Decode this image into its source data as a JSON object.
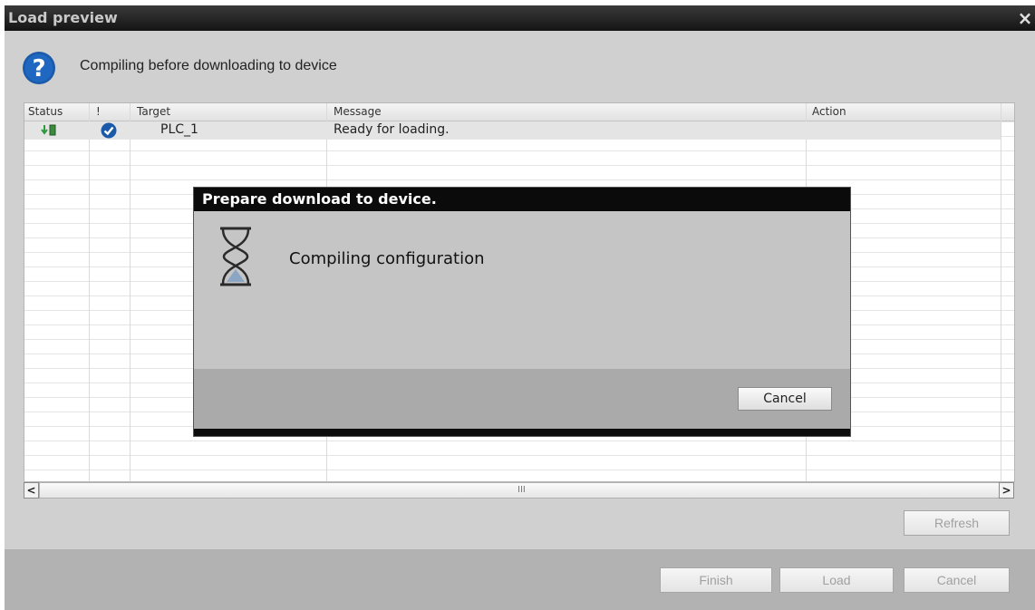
{
  "window": {
    "title": "Load preview",
    "close_symbol": "×"
  },
  "prompt": {
    "icon": "question-icon",
    "text": "Compiling before downloading to device"
  },
  "table": {
    "columns": [
      "Status",
      "!",
      "Target",
      "Message",
      "Action"
    ],
    "rows": [
      {
        "status_icon": "download-status-icon",
        "check_icon": "check-icon",
        "target": "PLC_1",
        "message": "Ready for loading.",
        "action": ""
      }
    ]
  },
  "scrollbar": {
    "left_arrow": "<",
    "right_arrow": ">",
    "grip": "III"
  },
  "buttons": {
    "refresh": "Refresh",
    "finish": "Finish",
    "load": "Load",
    "cancel": "Cancel"
  },
  "progress_dialog": {
    "title": "Prepare download to device.",
    "icon": "hourglass-icon",
    "text": "Compiling configuration",
    "cancel": "Cancel"
  },
  "colors": {
    "accent": "#1a5aa8",
    "titlebar": "#141414",
    "dialog_titlebar": "#0b0b0b"
  }
}
